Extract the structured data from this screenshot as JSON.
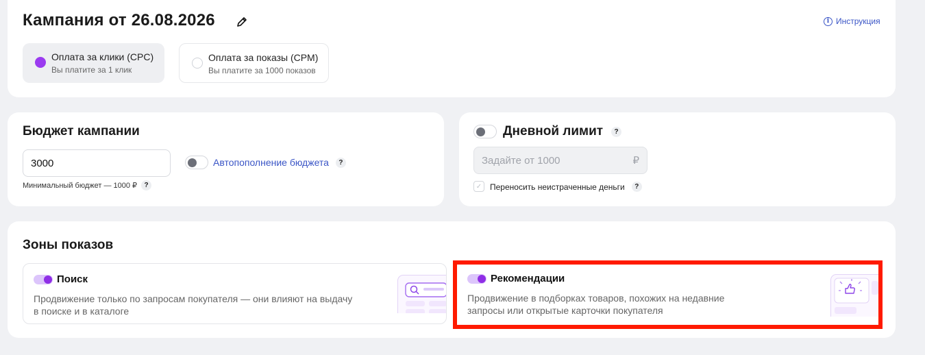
{
  "campaign": {
    "title": "Кампания от 26.08.2026",
    "instruction_link": "Инструкция",
    "payment_options": [
      {
        "label": "Оплата за клики (CPC)",
        "sub": "Вы платите за 1 клик",
        "selected": true
      },
      {
        "label": "Оплата за показы (CPM)",
        "sub": "Вы платите за 1000 показов",
        "selected": false
      }
    ]
  },
  "budget": {
    "title": "Бюджет кампании",
    "input_value": "3000",
    "min_note": "Минимальный бюджет — 1000 ₽",
    "auto_topup_label": "Автопополнение бюджета",
    "auto_topup_on": false
  },
  "daily_limit": {
    "title": "Дневной лимит",
    "enabled": false,
    "input_placeholder": "Задайте от 1000",
    "currency": "₽",
    "carry_over_label": "Переносить неистраченные деньги"
  },
  "zones": {
    "title": "Зоны показов",
    "items": [
      {
        "name": "Поиск",
        "desc_line1": "Продвижение только по запросам покупателя — они влияют на выдачу",
        "desc_line2": "в поиске и в каталоге",
        "enabled": true
      },
      {
        "name": "Рекомендации",
        "desc_line1": "Продвижение в подборках товаров, похожих на недавние",
        "desc_line2": "запросы или открытые карточки покупателя",
        "enabled": true
      }
    ]
  },
  "help_glyph": "?",
  "colors": {
    "accent": "#9b3bf0",
    "link": "#3a55c6",
    "highlight": "#ff1a00"
  }
}
